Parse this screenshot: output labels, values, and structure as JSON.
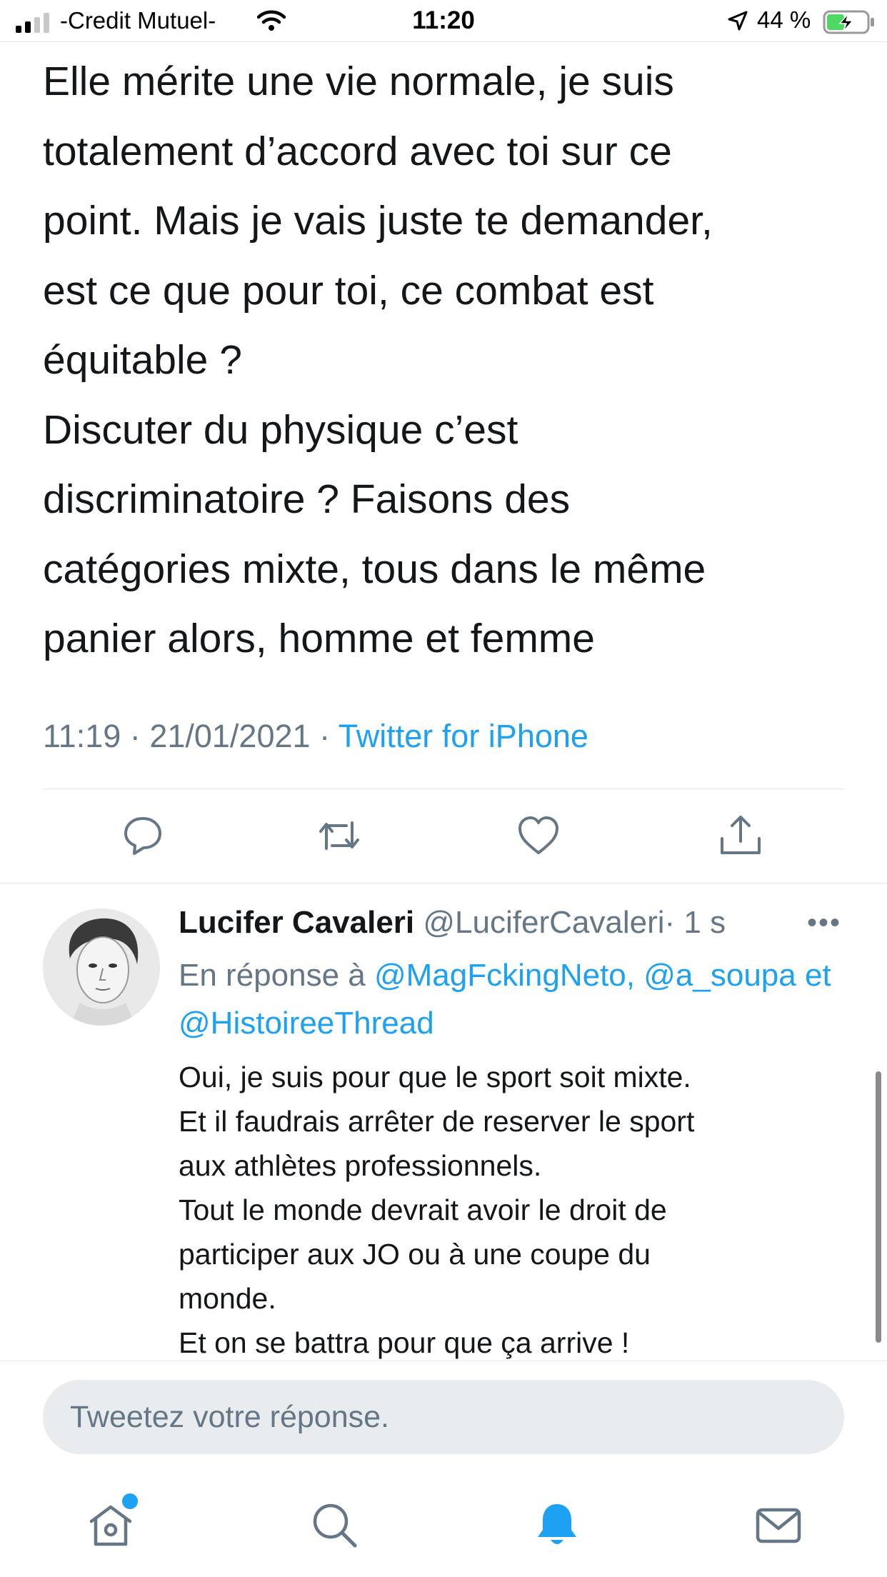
{
  "status_bar": {
    "carrier": "-Credit Mutuel-",
    "time": "11:20",
    "battery_percent": "44 %",
    "battery_level": 0.44,
    "signal_bars": 2
  },
  "tweet": {
    "text": "Elle mérite une vie normale, je suis\ntotalement d’accord avec toi sur ce\npoint. Mais je vais juste te demander,\nest ce que pour toi, ce combat est\néquitable ?\nDiscuter du physique c’est\ndiscriminatoire ? Faisons des\ncatégories mixte, tous dans le même\npanier alors, homme et femme",
    "time": "11:19",
    "date": "21/01/2021",
    "separator": "·",
    "source": "Twitter for iPhone"
  },
  "actions": [
    "reply-icon",
    "retweet-icon",
    "like-icon",
    "share-icon"
  ],
  "reply": {
    "name": "Lucifer Cavaleri",
    "handle": "@LuciferCavaleri",
    "time": "· 1 s",
    "more": "•••",
    "in_reply_prefix": "En réponse à",
    "mention1": "@MagFckingNeto,",
    "mention2": "@a_soupa",
    "conjunction": "et",
    "mention3": "@HistoireeThread",
    "text": "Oui, je suis pour que le sport soit mixte.\nEt il faudrais arrêter de reserver le sport\naux athlètes professionnels.\nTout le monde devrait avoir le droit de\nparticiper aux JO ou à une coupe du\nmonde.\nEt on se battra pour que ça arrive !"
  },
  "compose": {
    "placeholder": "Tweetez votre réponse."
  },
  "tab_bar": [
    "home-icon",
    "search-icon",
    "notifications-icon",
    "messages-icon"
  ],
  "colors": {
    "accent": "#1da1f2",
    "text": "#14171a",
    "secondary": "#657786",
    "battery_green": "#4cd964"
  }
}
